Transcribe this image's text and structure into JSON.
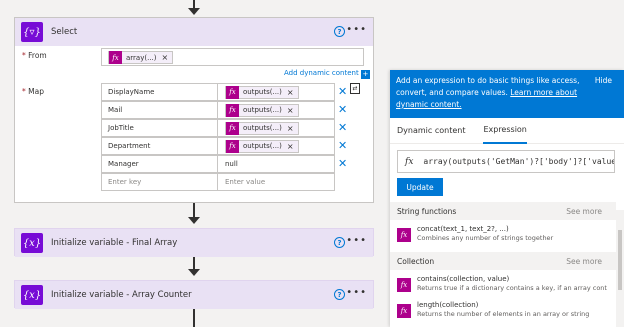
{
  "select_card": {
    "title": "Select",
    "from_label": "From",
    "from_token": "array(...)",
    "add_dynamic": "Add dynamic content",
    "map_label": "Map",
    "rows": [
      {
        "key": "DisplayName",
        "value_token": "outputs(...)"
      },
      {
        "key": "Mail",
        "value_token": "outputs(...)"
      },
      {
        "key": "JobTitle",
        "value_token": "outputs(...)"
      },
      {
        "key": "Department",
        "value_token": "outputs(...)"
      },
      {
        "key": "Manager",
        "value_text": "null"
      }
    ],
    "key_placeholder": "Enter key",
    "value_placeholder": "Enter value"
  },
  "card2": {
    "title": "Initialize variable - Final Array"
  },
  "card3": {
    "title": "Initialize variable - Array Counter"
  },
  "panel": {
    "info_line1": "Add an expression to do basic things like access,",
    "info_line2": "convert, and compare values.",
    "learn_more": "Learn more about",
    "learn_more2": "dynamic content.",
    "hide": "Hide",
    "tab_dynamic": "Dynamic content",
    "tab_expression": "Expression",
    "expression": "array(outputs('GetMan')?['body']?['value']",
    "update_label": "Update",
    "sections": [
      {
        "title": "String functions",
        "see_more": "See more"
      },
      {
        "title": "Collection",
        "see_more": "See more"
      }
    ],
    "functions": [
      {
        "name": "concat(text_1, text_2?, ...)",
        "desc": "Combines any number of strings together"
      },
      {
        "name": "contains(collection, value)",
        "desc": "Returns true if a dictionary contains a key, if an array cont"
      },
      {
        "name": "length(collection)",
        "desc": "Returns the number of elements in an array or string"
      }
    ]
  },
  "colors": {
    "accent": "#0078d4",
    "action_purple": "#770bd6",
    "token_magenta": "#ad008c",
    "header_bg": "#e9e1f4"
  }
}
